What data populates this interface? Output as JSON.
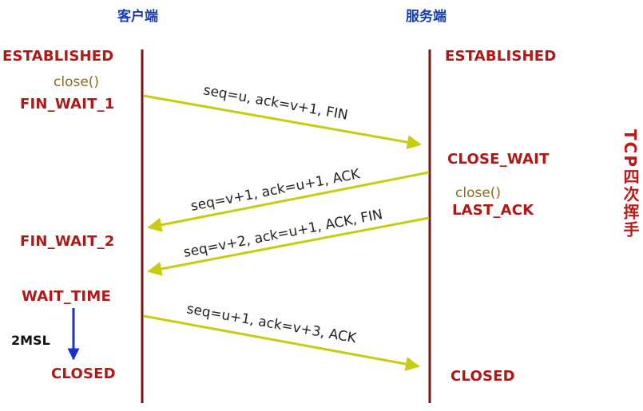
{
  "title": "TCP四次挥手",
  "parties": {
    "client": "客户端",
    "server": "服务端"
  },
  "client_states": {
    "established": "ESTABLISHED",
    "close_call": "close()",
    "fin_wait_1": "FIN_WAIT_1",
    "fin_wait_2": "FIN_WAIT_2",
    "wait_time": "WAIT_TIME",
    "msl": "2MSL",
    "closed": "CLOSED"
  },
  "server_states": {
    "established": "ESTABLISHED",
    "close_wait": "CLOSE_WAIT",
    "close_call": "close()",
    "last_ack": "LAST_ACK",
    "closed": "CLOSED"
  },
  "messages": [
    {
      "label": "seq=u, ack=v+1, FIN",
      "from": "client",
      "to": "server"
    },
    {
      "label": "seq=v+1, ack=u+1, ACK",
      "from": "server",
      "to": "client"
    },
    {
      "label": "seq=v+2, ack=u+1, ACK, FIN",
      "from": "server",
      "to": "client"
    },
    {
      "label": "seq=u+1, ack=v+3, ACK",
      "from": "client",
      "to": "server"
    }
  ],
  "colors": {
    "lifeline": "#7a1313",
    "arrow": "#c8cc10",
    "state": "#b01818",
    "party": "#1a3ea8",
    "timer_arrow": "#1a2fd0"
  }
}
